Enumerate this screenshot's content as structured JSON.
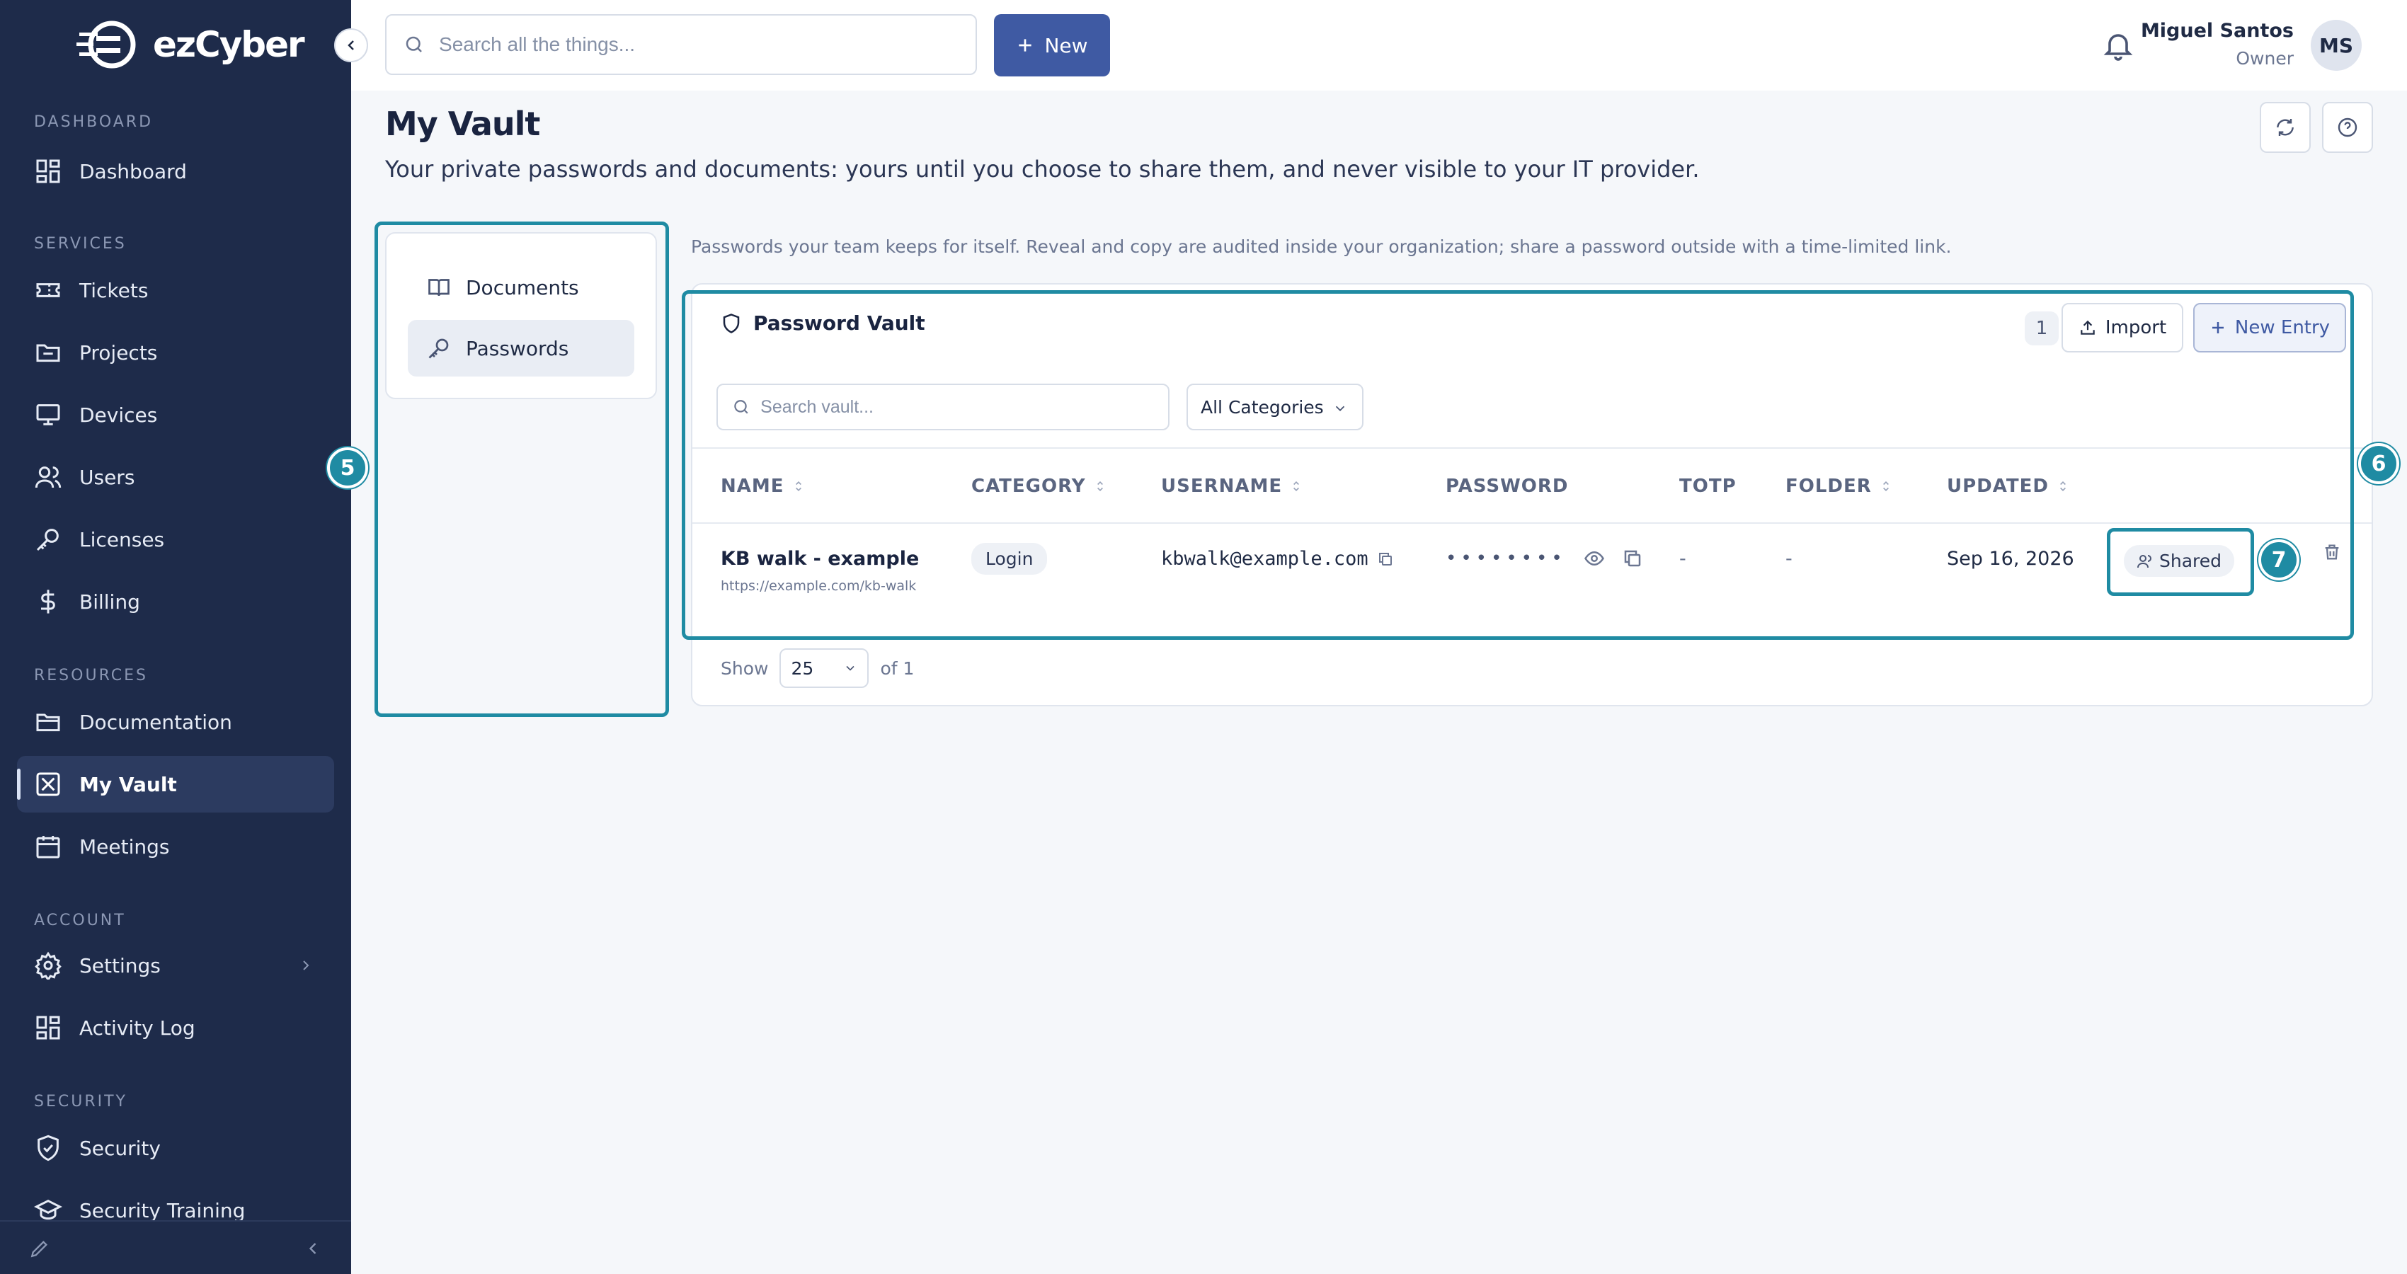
{
  "brand": {
    "name": "ezCyber"
  },
  "sidebar": {
    "sections": {
      "dashboard": "DASHBOARD",
      "services": "SERVICES",
      "resources": "RESOURCES",
      "account": "ACCOUNT",
      "security": "SECURITY"
    },
    "items": {
      "dashboard": "Dashboard",
      "tickets": "Tickets",
      "projects": "Projects",
      "devices": "Devices",
      "users": "Users",
      "licenses": "Licenses",
      "billing": "Billing",
      "documentation": "Documentation",
      "my_vault": "My Vault",
      "meetings": "Meetings",
      "settings": "Settings",
      "activity_log": "Activity Log",
      "security": "Security",
      "security_training": "Security Training"
    },
    "active": "my_vault"
  },
  "topbar": {
    "search_placeholder": "Search all the things...",
    "new_label": "New",
    "user": {
      "name": "Miguel Santos",
      "role": "Owner",
      "initials": "MS"
    }
  },
  "page": {
    "title": "My Vault",
    "subtitle": "Your private passwords and documents: yours until you choose to share them, and never visible to your IT provider."
  },
  "tabs": {
    "documents": "Documents",
    "passwords": "Passwords",
    "active": "passwords"
  },
  "vault": {
    "hint": "Passwords your team keeps for itself. Reveal and copy are audited inside your organization; share a password outside with a time-limited link.",
    "title": "Password Vault",
    "count": "1",
    "import_label": "Import",
    "new_entry_label": "New Entry",
    "search_placeholder": "Search vault...",
    "category_filter": "All Categories",
    "columns": {
      "name": "NAME",
      "category": "CATEGORY",
      "username": "USERNAME",
      "password": "PASSWORD",
      "totp": "TOTP",
      "folder": "FOLDER",
      "updated": "UPDATED"
    },
    "rows": [
      {
        "name": "KB walk - example",
        "url": "https://example.com/kb-walk",
        "category": "Login",
        "username": "kbwalk@example.com",
        "password_mask": "••••••••",
        "totp": "-",
        "folder": "-",
        "updated": "Sep 16, 2026",
        "shared_label": "Shared"
      }
    ],
    "footer": {
      "show_label": "Show",
      "page_size": "25",
      "page_of": "of 1"
    }
  },
  "annotations": {
    "five": "5",
    "six": "6",
    "seven": "7"
  },
  "colors": {
    "sidebar_bg": "#1e2b4a",
    "accent": "#3f5aa3",
    "annotation": "#1f8ba3"
  }
}
